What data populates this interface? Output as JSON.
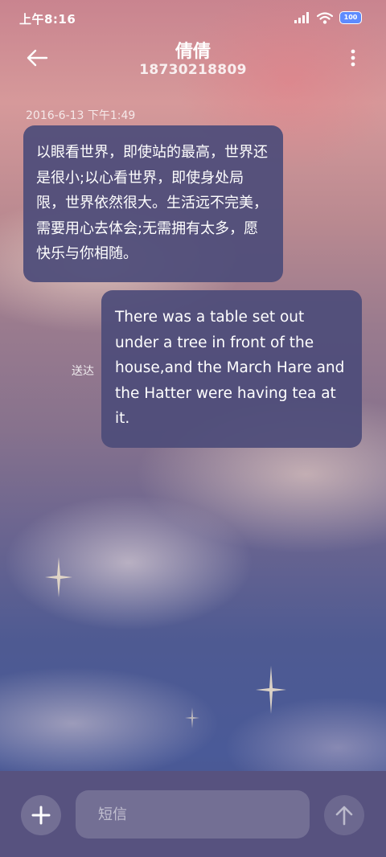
{
  "status_bar": {
    "time": "上午8:16",
    "battery": "100",
    "icons": [
      "signal-icon",
      "wifi-icon",
      "battery-icon"
    ]
  },
  "header": {
    "contact_name": "倩倩",
    "phone_number": "18730218809",
    "icons": [
      "back-arrow-icon",
      "more-vertical-icon"
    ]
  },
  "conversation": {
    "timestamp": "2016-6-13 下午1:49",
    "messages": [
      {
        "direction": "incoming",
        "text": "以眼看世界，即使站的最高，世界还是很小;以心看世界，即使身处局限，世界依然很大。生活远不完美，需要用心去体会;无需拥有太多，愿快乐与你相随。"
      },
      {
        "direction": "outgoing",
        "text": "There was a table set out under a tree in front of the house,and the March Hare and the Hatter were having tea at it.",
        "status": "送达"
      }
    ]
  },
  "composer": {
    "placeholder": "短信",
    "value": "",
    "icons": [
      "plus-icon",
      "send-arrow-icon"
    ]
  },
  "colors": {
    "bubble": "#4e4c7a",
    "composer_bg": "#57527f"
  }
}
